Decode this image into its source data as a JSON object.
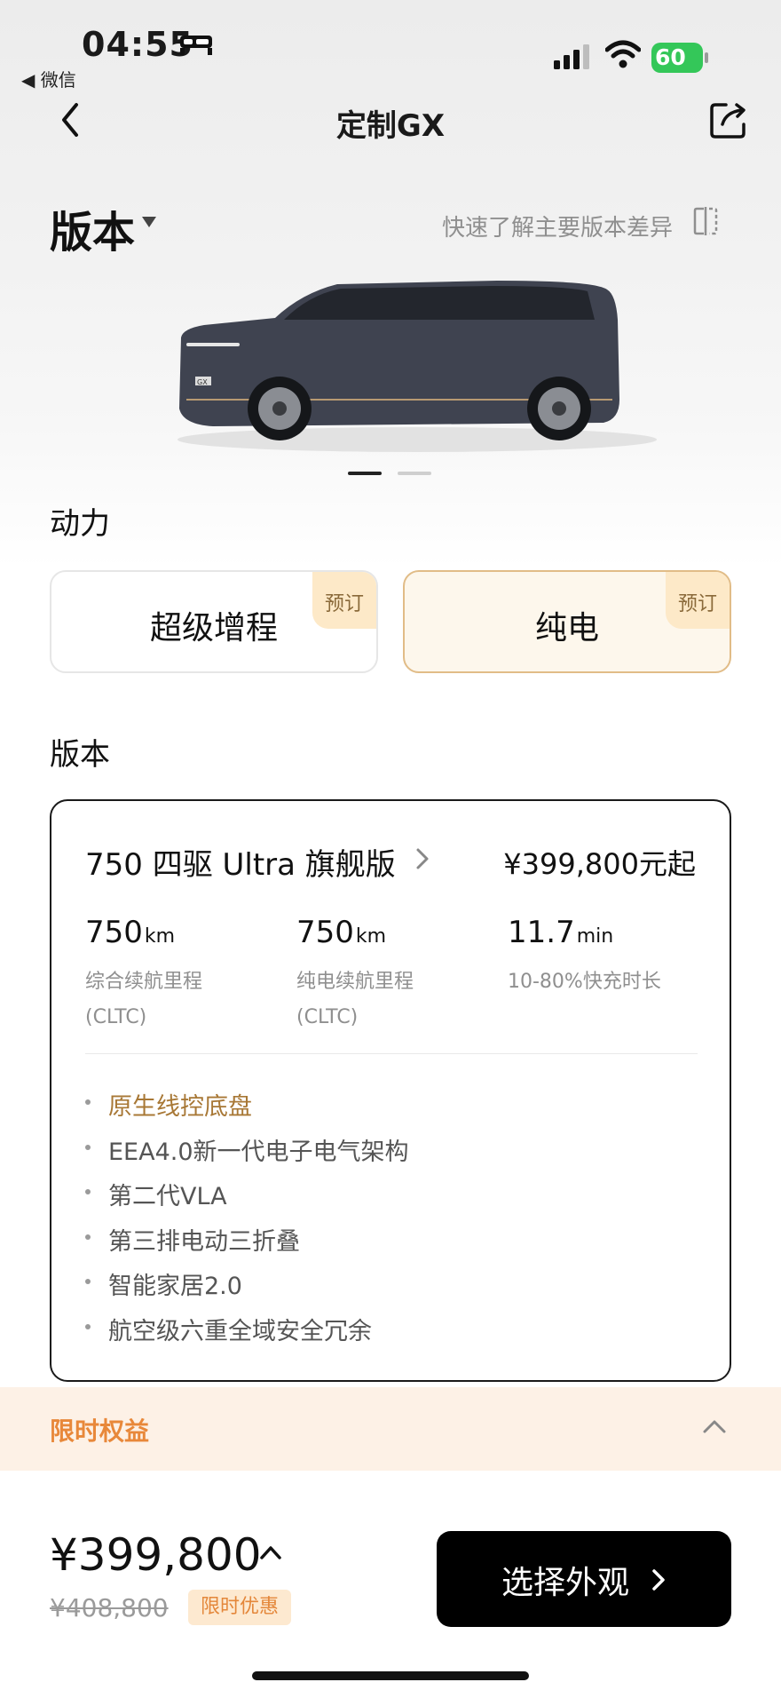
{
  "status_bar": {
    "time": "04:55",
    "back_app": "◀ 微信",
    "battery": "60"
  },
  "nav": {
    "title": "定制GX"
  },
  "version_header": {
    "title": "版本",
    "compare_text": "快速了解主要版本差异"
  },
  "gallery": {
    "car_badge": "GX",
    "active_index": 0,
    "count": 2
  },
  "power": {
    "label": "动力",
    "options": [
      {
        "label": "超级增程",
        "tag": "预订",
        "selected": false
      },
      {
        "label": "纯电",
        "tag": "预订",
        "selected": true
      }
    ]
  },
  "version_section": {
    "label": "版本",
    "card": {
      "name": "750 四驱 Ultra 旗舰版",
      "price": "¥399,800元起",
      "stats": [
        {
          "value": "750",
          "unit": "km",
          "label_line1": "综合续航里程",
          "label_line2": "(CLTC)"
        },
        {
          "value": "750",
          "unit": "km",
          "label_line1": "纯电续航里程",
          "label_line2": "(CLTC)"
        },
        {
          "value": "11.7",
          "unit": "min",
          "label_line1": "10-80%快充时长",
          "label_line2": ""
        }
      ],
      "features": [
        "原生线控底盘",
        "EEA4.0新一代电子电气架构",
        "第二代VLA",
        "第三排电动三折叠",
        "智能家居2.0",
        "航空级六重全域安全冗余"
      ]
    }
  },
  "benefits": {
    "title": "限时权益"
  },
  "footer": {
    "price": "¥399,800",
    "original_price": "¥408,800",
    "promo_tag": "限时优惠",
    "cta_label": "选择外观"
  },
  "colors": {
    "accent_gold": "#a87836",
    "benefit_orange": "#e8883a",
    "selected_bg": "#fdf7ec",
    "battery_green": "#34c759"
  }
}
